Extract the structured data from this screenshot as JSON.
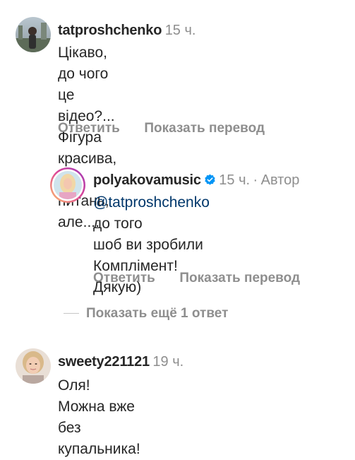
{
  "comments": [
    {
      "username": "tatproshchenko",
      "time": "15 ч.",
      "text": "Цікаво, до чого це відео?...\nФігура красива, без питань,\nале....",
      "reply_label": "Ответить",
      "translate_label": "Показать перевод",
      "avatar_icon": "user-photo-avatar"
    },
    {
      "username": "polyakovamusic",
      "verified_icon": "verified-badge-icon",
      "time": "15 ч.",
      "separator": "·",
      "author_label": "Автор",
      "mention": "@tatproshchenko",
      "text_after_mention": " до того\nшоб ви зробили\nКомплімент! Дякую)",
      "reply_label": "Ответить",
      "translate_label": "Показать перевод",
      "avatar_icon": "story-ring-avatar"
    },
    {
      "username": "sweety221121",
      "time": "19 ч.",
      "text": "Оля! Можна вже без\nкупальника!",
      "avatar_icon": "user-photo-avatar"
    }
  ],
  "more_replies_label": "Показать ещё 1 ответ",
  "colors": {
    "text": "#262626",
    "secondary": "#8e8e8e",
    "mention": "#00376b",
    "verified": "#0095f6"
  }
}
